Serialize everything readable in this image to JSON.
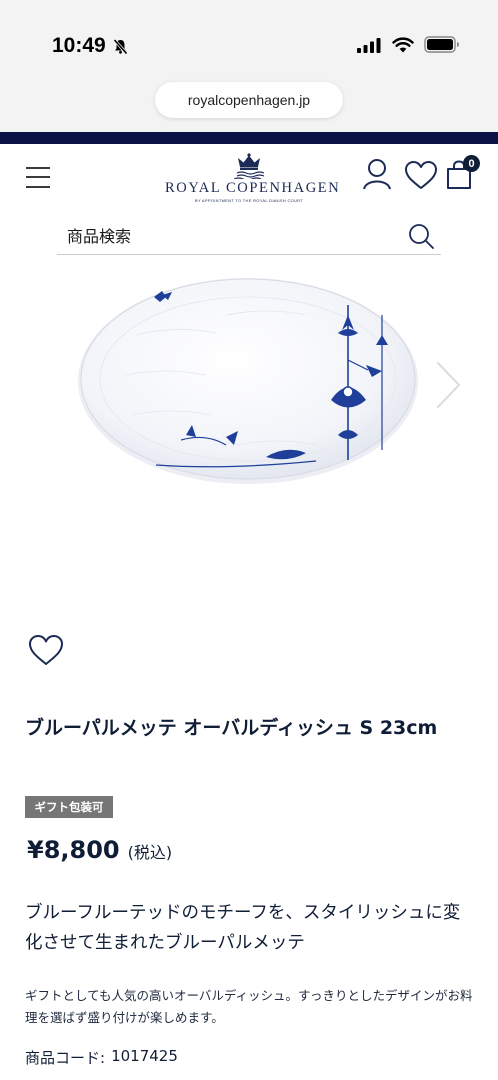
{
  "status_bar": {
    "time": "10:49"
  },
  "browser": {
    "url": "royalcopenhagen.jp"
  },
  "header": {
    "brand": "ROYAL COPENHAGEN",
    "brand_sub": "BY APPOINTMENT TO THE ROYAL DANISH COURT",
    "cart_count": "0"
  },
  "search": {
    "placeholder": "商品検索"
  },
  "product": {
    "title": "ブルーパルメッテ オーバルディッシュ S 23cm",
    "badge": "ギフト包装可",
    "price": "¥8,800",
    "tax_note": "(税込)",
    "catch_copy": "ブルーフルーテッドのモチーフを、スタイリッシュに変化させて生まれたブルーパルメッテ",
    "description": "ギフトとしても人気の高いオーバルディッシュ。すっきりとしたデザインがお料理を選ばず盛り付けが楽しめます。",
    "code_label": "商品コード:",
    "code_value": "1017425"
  },
  "colors": {
    "navy": "#0b1246",
    "text": "#0f1e36",
    "badge_bg": "#767676",
    "pattern_blue": "#1f3f9a"
  }
}
